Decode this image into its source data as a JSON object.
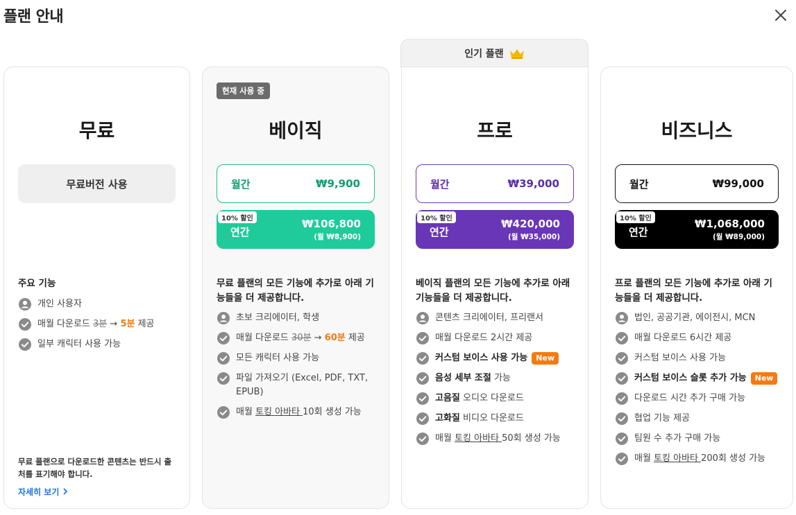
{
  "header": {
    "title": "플랜 안내"
  },
  "popular_tab": {
    "label": "인기 플랜"
  },
  "plans": {
    "free": {
      "name": "무료",
      "button": "무료버전 사용",
      "features_title": "주요 기능",
      "features": [
        "개인 사용자",
        "매월 다운로드 ",
        "3분",
        " → ",
        "5분",
        " 제공",
        "일부 캐릭터 사용 가능"
      ],
      "note": "무료 플랜으로 다운로드한 콘텐츠는 반드시 출처를 표기해야 합니다.",
      "more_link": "자세히 보기"
    },
    "basic": {
      "badge": "현재 사용 중",
      "name": "베이직",
      "monthly_label": "월간",
      "monthly_price": "₩9,900",
      "discount": "10% 할인",
      "annual_label": "연간",
      "annual_price": "₩106,800",
      "annual_sub": "(월 ₩8,900)",
      "features_title": "무료 플랜의 모든 기능에 추가로 아래 기능들을 더 제공합니다.",
      "f1": "초보 크리에이터, 학생",
      "f2a": "매월 다운로드 ",
      "f2b": "30분",
      "f2c": " → ",
      "f2d": "60분",
      "f2e": " 제공",
      "f3": "모든 캐릭터 사용 가능",
      "f4": "파일 가져오기 (Excel, PDF, TXT, EPUB)",
      "f5a": "매월 ",
      "f5b": "토킹 아바타 ",
      "f5c": "10회 생성 가능"
    },
    "pro": {
      "name": "프로",
      "monthly_label": "월간",
      "monthly_price": "₩39,000",
      "discount": "10% 할인",
      "annual_label": "연간",
      "annual_price": "₩420,000",
      "annual_sub": "(월 ₩35,000)",
      "features_title": "베이직 플랜의 모든 기능에 추가로 아래 기능들을 더 제공합니다.",
      "f1": "콘텐츠 크리에이터, 프리랜서",
      "f2": "매월 다운로드 2시간  제공",
      "f3": "커스텀 보이스 사용 가능",
      "new": "New",
      "f4a": "음성 세부 조절",
      "f4b": " 가능",
      "f5a": "고음질",
      "f5b": " 오디오 다운로드",
      "f6a": "고화질",
      "f6b": " 비디오 다운로드",
      "f7a": "매월 ",
      "f7b": "토킹 아바타 ",
      "f7c": "50회 생성 가능"
    },
    "biz": {
      "name": "비즈니스",
      "monthly_label": "월간",
      "monthly_price": "₩99,000",
      "discount": "10% 할인",
      "annual_label": "연간",
      "annual_price": "₩1,068,000",
      "annual_sub": "(월 ₩89,000)",
      "features_title": "프로 플랜의 모든 기능에 추가로 아래 기능들을 더 제공합니다.",
      "f1": "법인, 공공기관, 에이전시, MCN",
      "f2": "매월 다운로드 6시간  제공",
      "f3": "커스텀 보이스 사용 가능",
      "f4": "커스텀 보이스 슬롯 추가 가능",
      "new": "New",
      "f5": "다운로드 시간 추가 구매 가능",
      "f6": "협업 기능 제공",
      "f7": "팀원 수 추가 구매 가능",
      "f8a": "매월 ",
      "f8b": "토킹 아바타 ",
      "f8c": "200회 생성 가능"
    }
  },
  "colors": {
    "basic_accent": "#1fcb9b",
    "pro_accent": "#6936b8",
    "biz_accent": "#000000",
    "orange": "#f07b14",
    "link": "#1a73e8"
  }
}
